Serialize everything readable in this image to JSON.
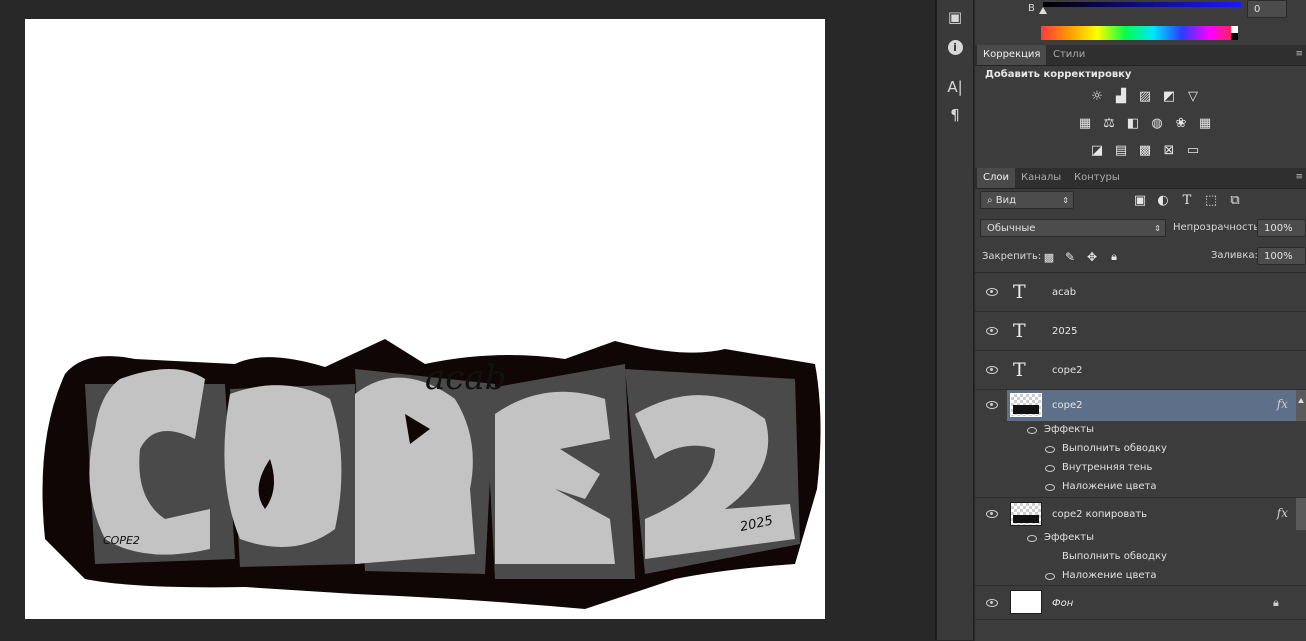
{
  "colorPanel": {
    "channel_label": "B",
    "channel_value": "0"
  },
  "adjustments": {
    "tabs": [
      "Коррекция",
      "Стили"
    ],
    "heading": "Добавить корректировку",
    "icons": [
      "brightness-icon",
      "levels-icon",
      "curves-icon",
      "exposure-icon",
      "vibrance-icon",
      "hue-saturation-icon",
      "color-balance-icon",
      "black-white-icon",
      "photo-filter-icon",
      "channel-mixer-icon",
      "color-lookup-icon",
      "invert-icon",
      "posterize-icon",
      "threshold-icon",
      "selective-color-icon",
      "gradient-map-icon"
    ]
  },
  "layersPanel": {
    "tabs": [
      "Слои",
      "Каналы",
      "Контуры"
    ],
    "filter_kind": "Вид",
    "blend_mode": "Обычные",
    "opacity_label": "Непрозрачность:",
    "opacity_value": "100%",
    "lock_label": "Закрепить:",
    "fill_label": "Заливка:",
    "fill_value": "100%",
    "layers": [
      {
        "name": "acab",
        "type": "text"
      },
      {
        "name": "2025",
        "type": "text"
      },
      {
        "name": "cope2",
        "type": "text"
      },
      {
        "name": "cope2",
        "type": "image",
        "selected": true,
        "effects_label": "Эффекты",
        "effects": [
          "Выполнить обводку",
          "Внутренняя тень",
          "Наложение цвета"
        ]
      },
      {
        "name": "cope2 копировать",
        "type": "image",
        "effects_label": "Эффекты",
        "effects": [
          "Выполнить обводку",
          "Наложение цвета"
        ]
      },
      {
        "name": "Фон",
        "type": "background"
      }
    ],
    "fx_label": "fx"
  },
  "canvas": {
    "main_text": "COPE2",
    "tag_text": "acab",
    "small_tag": "COPE2",
    "year_text": "2025"
  },
  "colors": {
    "panel": "#3c3c3c",
    "selected_layer": "#5e6f8a",
    "letter_fill": "#c3c3c3",
    "outline": "#110606"
  }
}
